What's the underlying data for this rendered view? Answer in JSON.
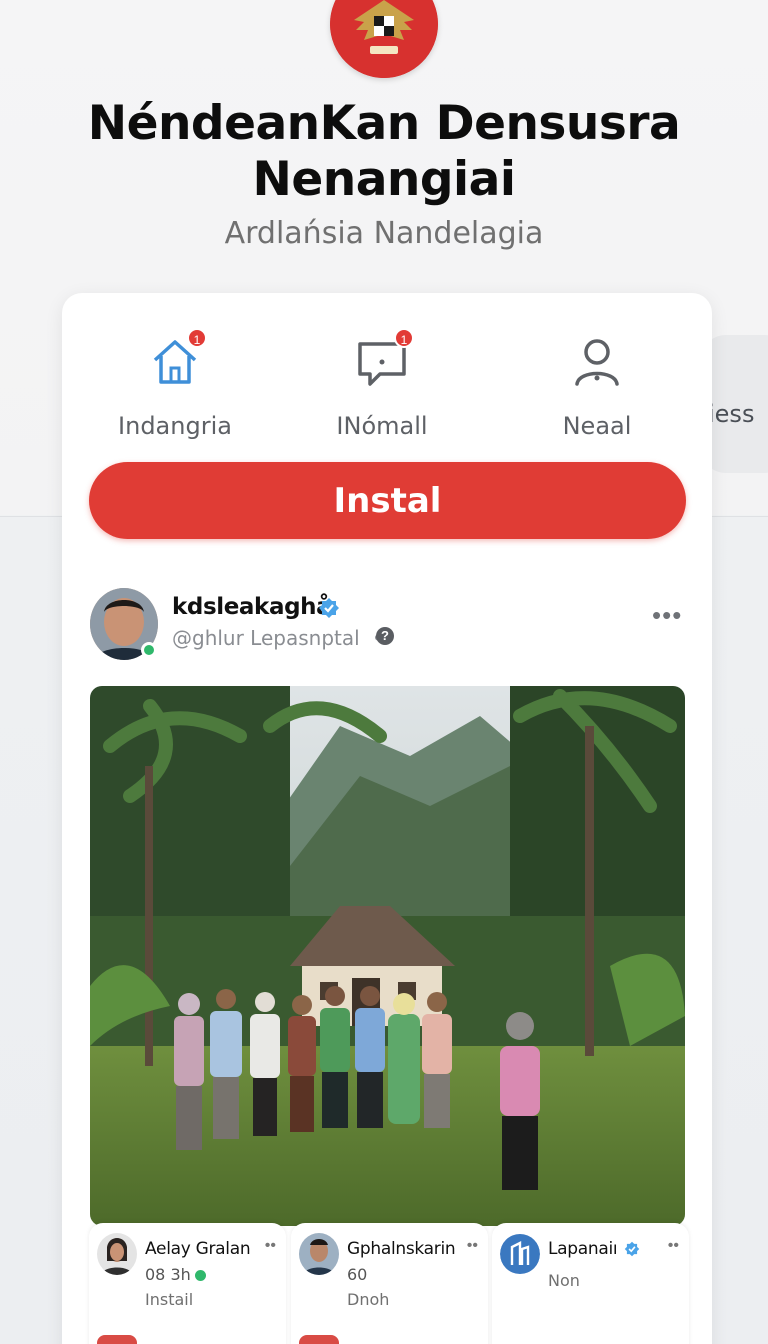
{
  "header": {
    "emblem": "garuda-emblem",
    "emblem_caption": "",
    "title_line1": "NéndeanKan Densusra",
    "title_line2": "Nenangiai",
    "subtitle": "Ardlańsia Nandelagia"
  },
  "peek": {
    "label": "iess"
  },
  "nav": [
    {
      "label": "Indangria",
      "icon": "home-icon",
      "badge": "1",
      "color": "#3f8fd8"
    },
    {
      "label": "INómall",
      "icon": "chat-icon",
      "badge": "1",
      "color": "#5e6166"
    },
    {
      "label": "Neaal",
      "icon": "user-icon",
      "badge": "",
      "color": "#5e6166"
    }
  ],
  "install": {
    "label": "Instal",
    "color": "#e03c35"
  },
  "post": {
    "name": "kdsleakaghå",
    "handle": "@ghlur Lepasnptal",
    "separator": "•",
    "help": "?",
    "more": "•••"
  },
  "mini_cards": [
    {
      "name": "Aelay Gralan",
      "meta": "08 3h",
      "sub": "Instail",
      "more": "••"
    },
    {
      "name": "Gphalnskarin",
      "meta": "60",
      "sub": "Dnoh",
      "more": "••"
    },
    {
      "name": "Lapanaiı",
      "meta": "",
      "sub": "Non",
      "more": "••"
    }
  ],
  "colors": {
    "accent": "#e03c35",
    "verified": "#4aa3e8",
    "online": "#2fb86b"
  }
}
